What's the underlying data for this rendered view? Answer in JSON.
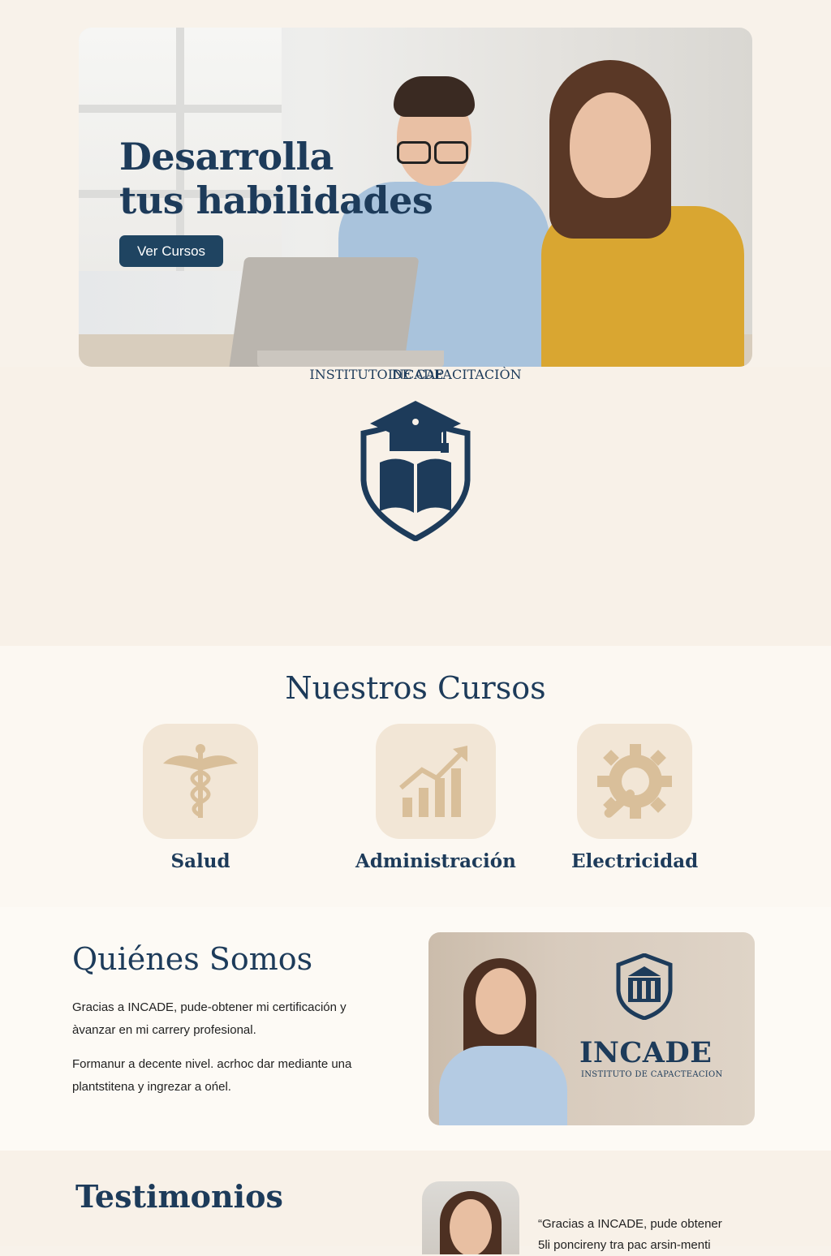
{
  "hero": {
    "title_line1": "Desarrolla",
    "title_line2": "tus habilidades",
    "cta_label": "Ver Cursos"
  },
  "brand": {
    "name": "INCADE",
    "subtitle": "INSTITUTO DE CAPACITACIÒN",
    "icon": "graduation-shield-book-icon"
  },
  "courses": {
    "heading": "Nuestros Cursos",
    "items": [
      {
        "label": "Salud",
        "icon": "caduceus-icon"
      },
      {
        "label": "Administración",
        "icon": "growth-chart-icon"
      },
      {
        "label": "Electricidad",
        "icon": "gear-wrench-icon"
      }
    ]
  },
  "about": {
    "heading": "Quiénes Somos",
    "paragraph1": "Gracias a INCADE, pude-obtener mi certificación y àvanzar en mi carrery profesional.",
    "paragraph2": "Formanur a decente nivel. acrhoc dar mediante una plantstitena y ingrezar a ońel.",
    "card_brand_name": "INCADE",
    "card_brand_subtitle": "INSTITUTO DE CAPACTEACION"
  },
  "testimonials": {
    "heading": "Testimonios",
    "quote_line1": "“Gracias a INCADE, pude obtener",
    "quote_line2": "5li poncireny tra pac arsin-menti"
  },
  "colors": {
    "navy": "#1d3b5a",
    "beige_tile": "#f2e6d6",
    "icon_tan": "#d9bf9a",
    "background": "#f8f2ea"
  }
}
